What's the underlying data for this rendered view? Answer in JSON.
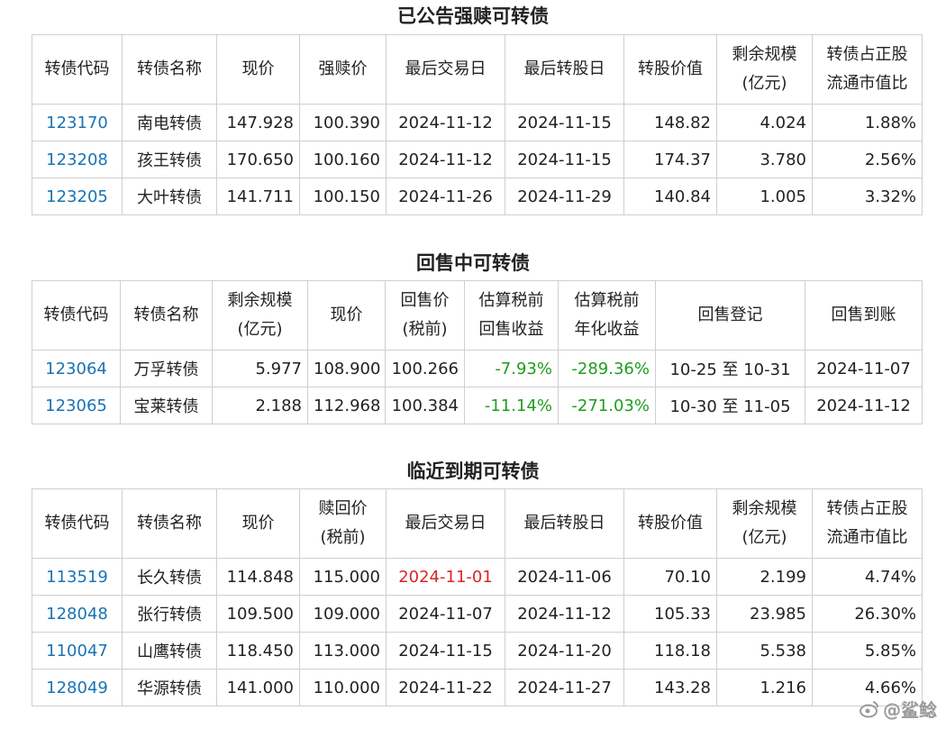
{
  "sections": {
    "redeem": {
      "title": "已公告强赎可转债",
      "headers": [
        "转债代码",
        "转债名称",
        "现价",
        "强赎价",
        "最后交易日",
        "最后转股日",
        "转股价值",
        "剩余规模\n(亿元)",
        "转债占正股\n流通市值比"
      ],
      "rows": [
        [
          "123170",
          "南电转债",
          "147.928",
          "100.390",
          "2024-11-12",
          "2024-11-15",
          "148.82",
          "4.024",
          "1.88%"
        ],
        [
          "123208",
          "孩王转债",
          "170.650",
          "100.160",
          "2024-11-12",
          "2024-11-15",
          "174.37",
          "3.780",
          "2.56%"
        ],
        [
          "123205",
          "大叶转债",
          "141.711",
          "100.150",
          "2024-11-26",
          "2024-11-29",
          "140.84",
          "1.005",
          "3.32%"
        ]
      ]
    },
    "putback": {
      "title": "回售中可转债",
      "headers": [
        "转债代码",
        "转债名称",
        "剩余规模\n(亿元)",
        "现价",
        "回售价\n(税前)",
        "估算税前\n回售收益",
        "估算税前\n年化收益",
        "回售登记",
        "回售到账"
      ],
      "rows": [
        [
          "123064",
          "万孚转债",
          "5.977",
          "108.900",
          "100.266",
          "-7.93%",
          "-289.36%",
          "10-25 至 10-31",
          "2024-11-07"
        ],
        [
          "123065",
          "宝莱转债",
          "2.188",
          "112.968",
          "100.384",
          "-11.14%",
          "-271.03%",
          "10-30 至 11-05",
          "2024-11-12"
        ]
      ]
    },
    "maturity": {
      "title": "临近到期可转债",
      "headers": [
        "转债代码",
        "转债名称",
        "现价",
        "赎回价\n(税前)",
        "最后交易日",
        "最后转股日",
        "转股价值",
        "剩余规模\n(亿元)",
        "转债占正股\n流通市值比"
      ],
      "rows": [
        [
          "113519",
          "长久转债",
          "114.848",
          "115.000",
          "2024-11-01",
          "2024-11-06",
          "70.10",
          "2.199",
          "4.74%"
        ],
        [
          "128048",
          "张行转债",
          "109.500",
          "109.000",
          "2024-11-07",
          "2024-11-12",
          "105.33",
          "23.985",
          "26.30%"
        ],
        [
          "110047",
          "山鹰转债",
          "118.450",
          "113.000",
          "2024-11-15",
          "2024-11-20",
          "118.18",
          "5.538",
          "5.85%"
        ],
        [
          "128049",
          "华源转债",
          "141.000",
          "110.000",
          "2024-11-22",
          "2024-11-27",
          "143.28",
          "1.216",
          "4.66%"
        ]
      ]
    }
  },
  "watermark": {
    "text": "@鲨鲶"
  },
  "colors": {
    "code": "#1a73b5",
    "gain_negative": "#1f9d1f",
    "highlight_date": "#d62828",
    "border": "#cfcfcf"
  }
}
